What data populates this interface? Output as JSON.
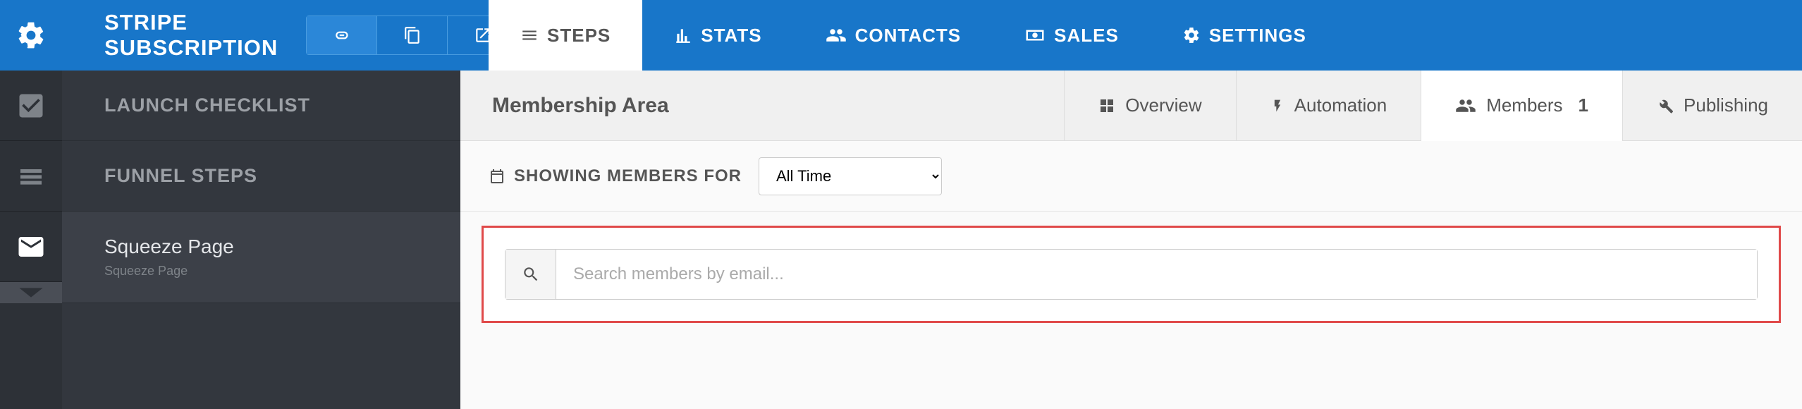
{
  "header": {
    "title": "STRIPE SUBSCRIPTION",
    "nav": {
      "steps": "STEPS",
      "stats": "STATS",
      "contacts": "CONTACTS",
      "sales": "SALES",
      "settings": "SETTINGS"
    }
  },
  "sidebar": {
    "launch_checklist": "LAUNCH CHECKLIST",
    "funnel_steps": "FUNNEL STEPS",
    "step1": {
      "title": "Squeeze Page",
      "sub": "Squeeze Page"
    }
  },
  "main": {
    "title": "Membership Area",
    "tabs": {
      "overview": "Overview",
      "automation": "Automation",
      "members": "Members",
      "members_count": "1",
      "publishing": "Publishing"
    },
    "filter": {
      "label": "SHOWING MEMBERS FOR",
      "value": "All Time"
    },
    "search": {
      "placeholder": "Search members by email..."
    }
  }
}
